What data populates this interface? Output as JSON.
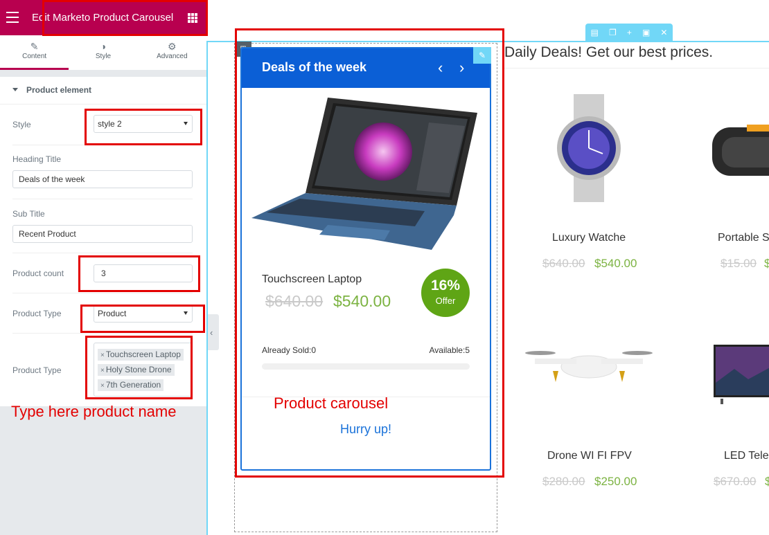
{
  "panel": {
    "title": "Edit Marketo Product Carousel",
    "tabs": [
      {
        "label": "Content",
        "icon": "pencil-icon"
      },
      {
        "label": "Style",
        "icon": "contrast-icon"
      },
      {
        "label": "Advanced",
        "icon": "gear-icon"
      }
    ],
    "section_title": "Product element",
    "controls": {
      "style_label": "Style",
      "style_value": "style 2",
      "heading_label": "Heading Title",
      "heading_value": "Deals of the week",
      "subtitle_label": "Sub Title",
      "subtitle_value": "Recent Product",
      "count_label": "Product count",
      "count_value": "3",
      "type_label": "Product Type",
      "type_value": "Product",
      "products_label": "Product Type",
      "products": [
        "Touchscreen Laptop",
        "Holy Stone Drone",
        "7th Generation"
      ]
    },
    "hint": "Type here product name"
  },
  "colors": {
    "brand": "#b8004f",
    "accent_blue": "#0b5fd6",
    "price_green": "#7cb342",
    "annotation_red": "#e30000",
    "editor_cyan": "#71d7f7"
  },
  "carousel": {
    "heading": "Deals of the week",
    "product_name": "Touchscreen Laptop",
    "old_price": "$640.00",
    "new_price": "$540.00",
    "offer_pct": "16%",
    "offer_label": "Offer",
    "sold": "Already Sold:0",
    "available": "Available:5",
    "sold_fraction": 0,
    "annotation": "Product carousel",
    "hurry": "Hurry up!"
  },
  "daily": {
    "title": "Daily Deals! Get our best prices.",
    "items": [
      {
        "name": "Luxury Watche",
        "old": "$640.00",
        "new": "$540.00"
      },
      {
        "name": "Portable S",
        "old": "$15.00",
        "new": "$"
      },
      {
        "name": "Drone WI FI FPV",
        "old": "$280.00",
        "new": "$250.00"
      },
      {
        "name": "LED Tele",
        "old": "$670.00",
        "new": "$"
      }
    ]
  }
}
